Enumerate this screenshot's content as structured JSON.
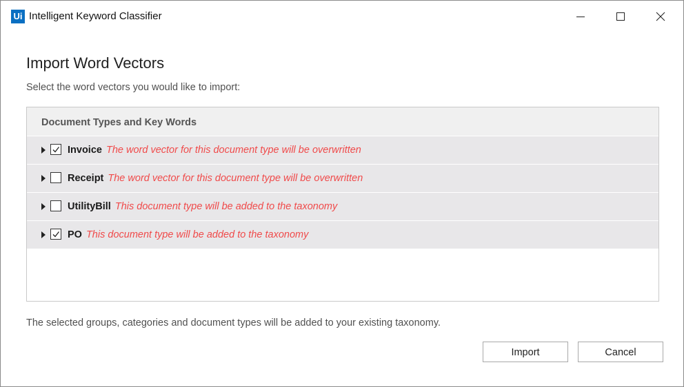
{
  "window": {
    "logo_text": "Ui",
    "title": "Intelligent Keyword Classifier"
  },
  "dialog": {
    "heading": "Import Word Vectors",
    "subtitle": "Select the word vectors you would like to import:",
    "tree_header": "Document Types and Key Words",
    "items": [
      {
        "name": "Invoice",
        "checked": true,
        "note": "The word vector for this document type will be overwritten"
      },
      {
        "name": "Receipt",
        "checked": false,
        "note": "The word vector for this document type will be overwritten"
      },
      {
        "name": "UtilityBill",
        "checked": false,
        "note": "This document type will be added to the taxonomy"
      },
      {
        "name": "PO",
        "checked": true,
        "note": "This document type will be added to the taxonomy"
      }
    ],
    "footer_note": "The selected groups, categories and document types will be added to your existing taxonomy.",
    "import_label": "Import",
    "cancel_label": "Cancel"
  },
  "colors": {
    "logo_bg": "#0a6fc2",
    "note_text": "#f04a4a",
    "row_bg": "#e8e7e9",
    "header_bg": "#f0f0f0"
  },
  "icons": {
    "minimize": "minimize-icon",
    "maximize": "maximize-icon",
    "close": "close-icon",
    "expander": "expand-arrow-icon",
    "check": "checkmark-icon"
  }
}
